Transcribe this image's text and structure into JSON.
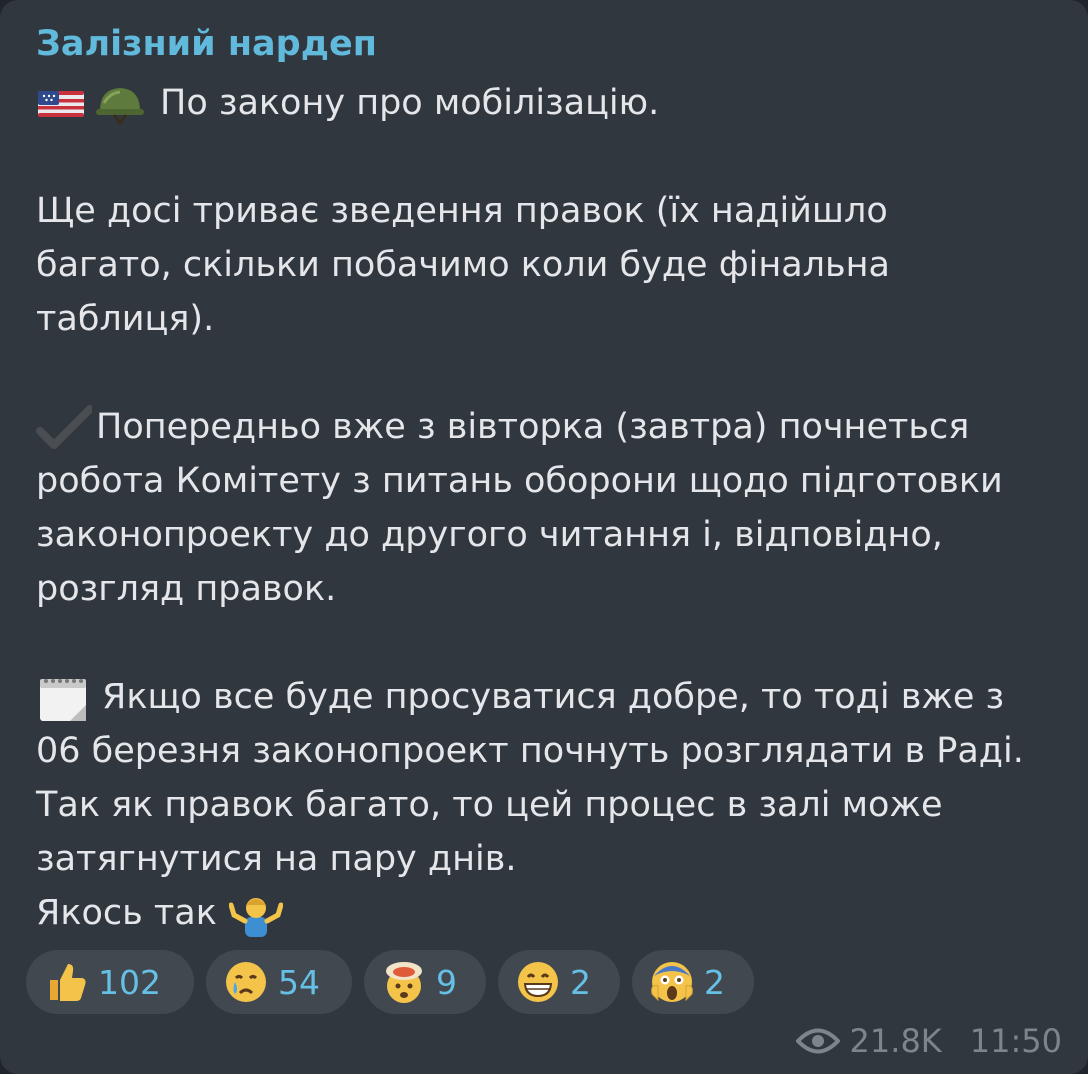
{
  "message": {
    "channel_name": "Залізний нардеп",
    "lines": {
      "l1": "По закону про мобілізацію.",
      "l2": "Ще досі триває зведення правок (їх надійшло",
      "l3": "багато, скільки побачимо коли буде фінальна",
      "l4": "таблиця).",
      "l5": "Попередньо вже з вівторка (завтра) почнеться",
      "l6": "робота Комітету з питань оборони щодо підготовки",
      "l7": "законопроекту до другого читання і, відповідно,",
      "l8": "розгляд правок.",
      "l9": "Якщо все буде просуватися добре, то тоді вже з",
      "l10": "06 березня законопроект почнуть розглядати в Раді.",
      "l11": "Так як правок багато, то цей процес в залі може",
      "l12": "затягнутися на пару днів.",
      "l13": "Якось так"
    },
    "icons": [
      "us-flag-icon",
      "military-helmet-icon",
      "check-mark-icon",
      "calendar-icon",
      "person-shrugging-icon"
    ]
  },
  "reactions": [
    {
      "icon": "thumbs-up-icon",
      "count": "102"
    },
    {
      "icon": "crying-face-icon",
      "count": "54"
    },
    {
      "icon": "exploding-head-icon",
      "count": "9"
    },
    {
      "icon": "grinning-face-icon",
      "count": "2"
    },
    {
      "icon": "screaming-face-icon",
      "count": "2"
    }
  ],
  "meta": {
    "views": "21.8K",
    "time": "11:50"
  },
  "colors": {
    "bubble": "#31373e",
    "channel_name": "#61b9dc",
    "text": "#e4e6e9",
    "reaction_bg": "#42484f",
    "reaction_count": "#66c0e5",
    "meta": "#7d858c"
  }
}
